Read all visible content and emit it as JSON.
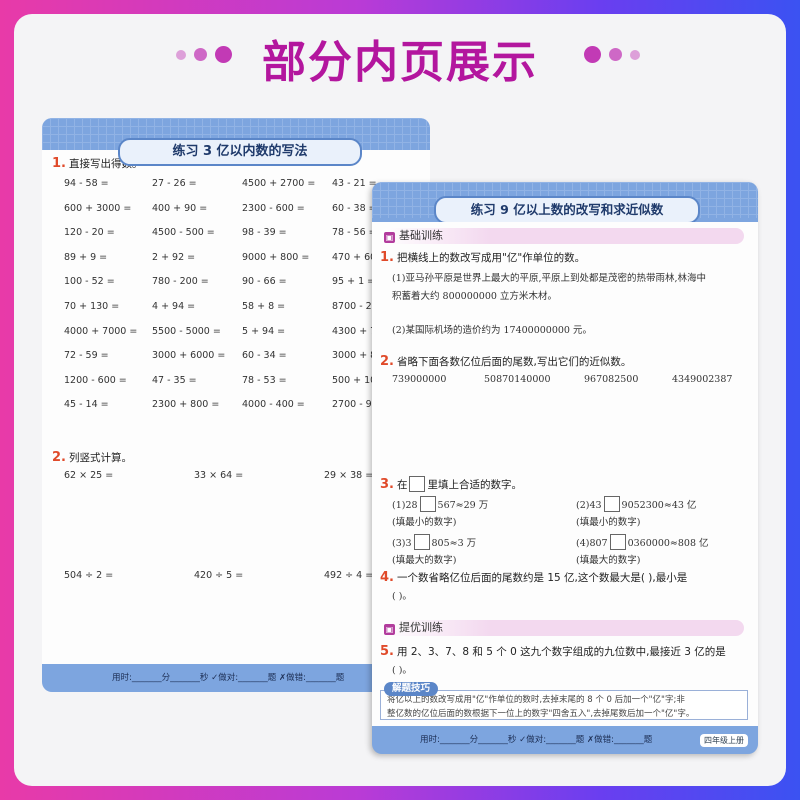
{
  "banner": {
    "title": "部分内页展示"
  },
  "page1": {
    "title": "练习 3   亿以内数的写法",
    "q1": {
      "num": "1.",
      "text": "直接写出得数。"
    },
    "calc": [
      [
        "94 - 58 =",
        "27 - 26 =",
        "4500 + 2700 =",
        "43 - 21 ="
      ],
      [
        "600 + 3000 =",
        "400 + 90 =",
        "2300 - 600 =",
        "60 - 38 ="
      ],
      [
        "120 - 20 =",
        "4500 - 500 =",
        "98 - 39 =",
        "78 - 56 ="
      ],
      [
        "89 + 9 =",
        "2 + 92 =",
        "9000 + 800 =",
        "470 + 60 ="
      ],
      [
        "100 - 52 =",
        "780 - 200 =",
        "90 - 66 =",
        "95 + 1 ="
      ],
      [
        "70 + 130 =",
        "4 + 94 =",
        "58 + 8 =",
        "8700 - 2"
      ],
      [
        "4000 + 7000 =",
        "5500 - 5000 =",
        "5 + 94 =",
        "4300 + 7"
      ],
      [
        "72 - 59 =",
        "3000 + 6000 =",
        "60 - 34 =",
        "3000 + 8"
      ],
      [
        "1200 - 600 =",
        "47 - 35 =",
        "78 - 53 =",
        "500 + 10"
      ],
      [
        "45 - 14 =",
        "2300 + 800 =",
        "4000 - 400 =",
        "2700 - 9"
      ]
    ],
    "q2": {
      "num": "2.",
      "text": "列竖式计算。"
    },
    "vertical": [
      "62 × 25 =",
      "33 × 64 =",
      "29 × 38 =",
      "504 ÷ 2 =",
      "420 ÷ 5 =",
      "492 ÷ 4 ="
    ],
    "footer": "用时:_______分_______秒   ✓做对:_______题   ✗做错:_______题"
  },
  "page2": {
    "title": "练习 9   亿以上数的改写和求近似数",
    "sec1": "基础训练",
    "q1": {
      "num": "1.",
      "text": "把横线上的数改写成用\"亿\"作单位的数。",
      "l1": "(1)亚马孙平原是世界上最大的平原,平原上到处都是茂密的热带雨林,林海中",
      "l2": "积蓄着大约 800000000 立方米木材。",
      "l3": "(2)某国际机场的造价约为 17400000000 元。"
    },
    "q2": {
      "num": "2.",
      "text": "省略下面各数亿位后面的尾数,写出它们的近似数。",
      "nums": [
        "739000000",
        "50870140000",
        "967082500",
        "4349002387"
      ]
    },
    "q3": {
      "num": "3.",
      "text_a": "在",
      "text_b": "里填上合适的数字。",
      "a1": "(1)28",
      "a1b": "567≈29 万",
      "a1n": "(填最小的数字)",
      "a2": "(2)43",
      "a2b": "9052300≈43 亿",
      "a2n": "(填最小的数字)",
      "a3": "(3)3",
      "a3b": "805≈3 万",
      "a3n": "(填最大的数字)",
      "a4": "(4)807",
      "a4b": "0360000≈808 亿",
      "a4n": "(填最大的数字)"
    },
    "q4": {
      "num": "4.",
      "text": "一个数省略亿位后面的尾数约是 15 亿,这个数最大是(          ),最小是",
      "text2": "(          )。"
    },
    "sec2": "提优训练",
    "q5": {
      "num": "5.",
      "text": "用 2、3、7、8 和 5 个 0 这九个数字组成的九位数中,最接近 3 亿的是",
      "text2": "(          )。"
    },
    "tip": {
      "badge": "解题技巧",
      "l1": "将亿以上的数改写成用\"亿\"作单位的数时,去掉末尾的 8 个 0 后加一个\"亿\"字;非",
      "l2": "整亿数的亿位后面的数根据下一位上的数字\"四舍五入\",去掉尾数后加一个\"亿\"字。"
    },
    "footer": "用时:_______分_______秒   ✓做对:_______题   ✗做错:_______题",
    "pageno": "四年级上册"
  }
}
